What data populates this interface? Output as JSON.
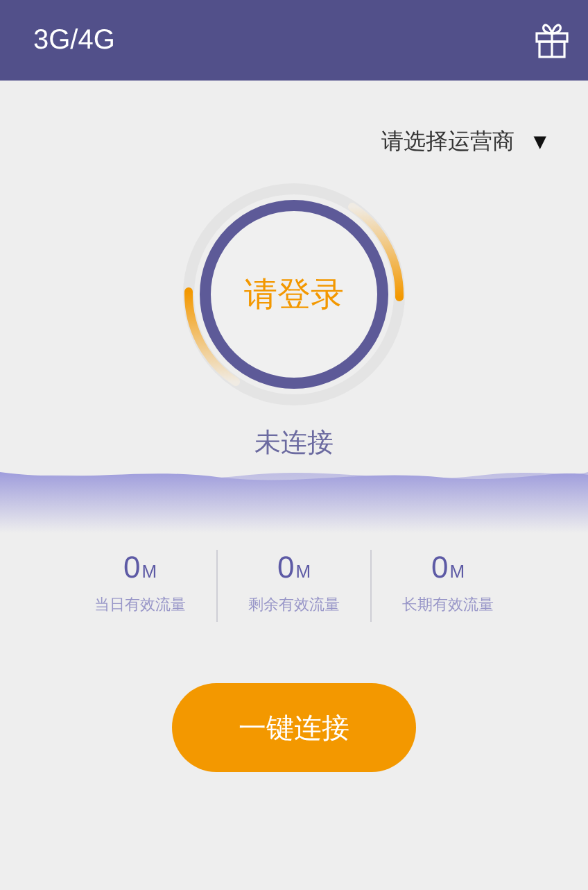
{
  "header": {
    "title": "3G/4G"
  },
  "operator_select": {
    "label": "请选择运营商",
    "caret": "▼"
  },
  "ring": {
    "label": "请登录"
  },
  "status": "未连接",
  "stats": [
    {
      "value": "0",
      "unit": "M",
      "label": "当日有效流量"
    },
    {
      "value": "0",
      "unit": "M",
      "label": "剩余有效流量"
    },
    {
      "value": "0",
      "unit": "M",
      "label": "长期有效流量"
    }
  ],
  "connect_button": "一键连接"
}
